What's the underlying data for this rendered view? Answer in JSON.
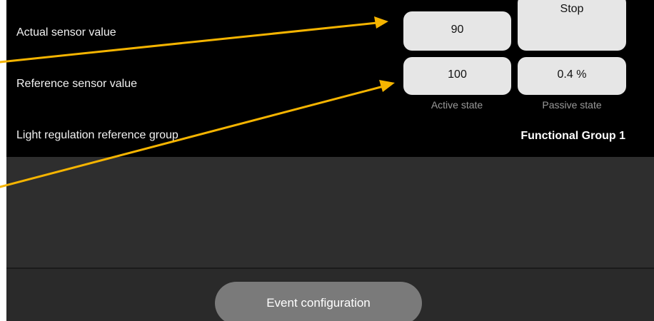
{
  "rows": {
    "actual_sensor_label": "Actual sensor value",
    "reference_sensor_label": "Reference sensor value",
    "light_group_label": "Light regulation reference group",
    "light_group_value": "Functional Group 1"
  },
  "values": {
    "actual_sensor": "90",
    "stop_label": "Stop",
    "reference_sensor": "100",
    "passive_value": "0.4 %"
  },
  "captions": {
    "active_state": "Active state",
    "passive_state": "Passive state"
  },
  "footer": {
    "event_configuration": "Event configuration"
  },
  "colors": {
    "annotation_arrow": "#f5b400",
    "panel_background": "#000000",
    "value_box": "#e6e6e6",
    "button": "#7a7a7a"
  }
}
